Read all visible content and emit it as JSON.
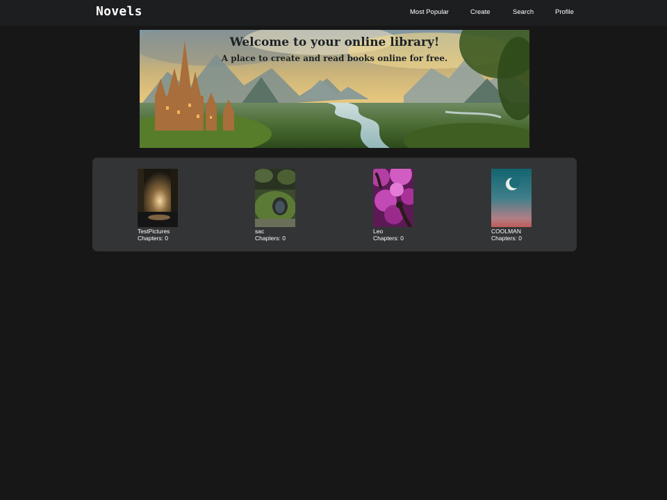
{
  "header": {
    "brand": "Novels",
    "nav": [
      {
        "label": "Most Popular"
      },
      {
        "label": "Create"
      },
      {
        "label": "Search"
      },
      {
        "label": "Profile"
      }
    ]
  },
  "banner": {
    "title": "Welcome to your online library!",
    "subtitle": "A place to create and read books online for free."
  },
  "books": [
    {
      "title": "TestPictures",
      "chapters_label": "Chapters: 0"
    },
    {
      "title": "sac",
      "chapters_label": "Chapters: 0"
    },
    {
      "title": "Leo",
      "chapters_label": "Chapters: 0"
    },
    {
      "title": "COOLMAN",
      "chapters_label": "Chapters: 0"
    }
  ],
  "colors": {
    "page_background": "#171718",
    "header_background": "#1d1e20",
    "panel_background": "#333436",
    "text": "#ffffff"
  }
}
